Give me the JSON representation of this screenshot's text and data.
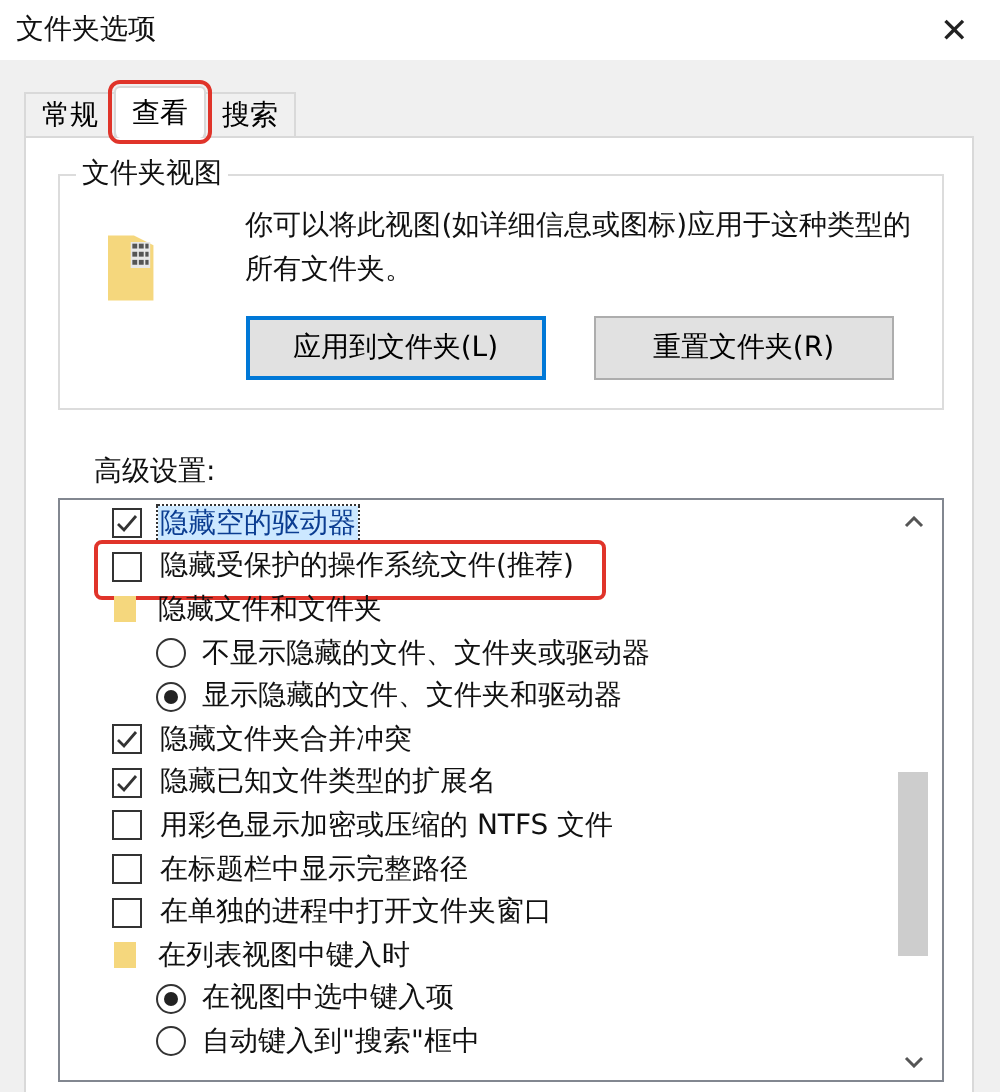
{
  "window": {
    "title": "文件夹选项",
    "close": "✕"
  },
  "tabs": [
    {
      "label": "常规",
      "selected": false,
      "highlighted": false
    },
    {
      "label": "查看",
      "selected": true,
      "highlighted": true
    },
    {
      "label": "搜索",
      "selected": false,
      "highlighted": false
    }
  ],
  "folder_views": {
    "title": "文件夹视图",
    "description": "你可以将此视图(如详细信息或图标)应用于这种类型的所有文件夹。",
    "buttons": [
      {
        "label": "应用到文件夹(L)",
        "selected": true
      },
      {
        "label": "重置文件夹(R)",
        "selected": false
      }
    ]
  },
  "advanced": {
    "label": "高级设置:",
    "items": [
      {
        "kind": "checkbox",
        "label": "隐藏空的驱动器",
        "checked": true,
        "selected": true,
        "highlighted": false
      },
      {
        "kind": "checkbox",
        "label": "隐藏受保护的操作系统文件(推荐)",
        "checked": false,
        "selected": false,
        "highlighted": true
      },
      {
        "kind": "folder",
        "label": "隐藏文件和文件夹",
        "selected": false,
        "highlighted": false,
        "children": [
          {
            "kind": "radio",
            "label": "不显示隐藏的文件、文件夹或驱动器",
            "checked": false,
            "selected": false,
            "highlighted": false
          },
          {
            "kind": "radio",
            "label": "显示隐藏的文件、文件夹和驱动器",
            "checked": true,
            "selected": false,
            "highlighted": false
          }
        ]
      },
      {
        "kind": "checkbox",
        "label": "隐藏文件夹合并冲突",
        "checked": true,
        "selected": false,
        "highlighted": false
      },
      {
        "kind": "checkbox",
        "label": "隐藏已知文件类型的扩展名",
        "checked": true,
        "selected": false,
        "highlighted": false
      },
      {
        "kind": "checkbox",
        "label": "用彩色显示加密或压缩的 NTFS 文件",
        "checked": false,
        "selected": false,
        "highlighted": false
      },
      {
        "kind": "checkbox",
        "label": "在标题栏中显示完整路径",
        "checked": false,
        "selected": false,
        "highlighted": false
      },
      {
        "kind": "checkbox",
        "label": "在单独的进程中打开文件夹窗口",
        "checked": false,
        "selected": false,
        "highlighted": false
      },
      {
        "kind": "folder",
        "label": "在列表视图中键入时",
        "selected": false,
        "highlighted": false,
        "children": [
          {
            "kind": "radio",
            "label": "在视图中选中键入项",
            "checked": true,
            "selected": false,
            "highlighted": false
          },
          {
            "kind": "radio",
            "label": "自动键入到\"搜索\"框中",
            "checked": false,
            "selected": false,
            "highlighted": false
          }
        ]
      }
    ]
  }
}
